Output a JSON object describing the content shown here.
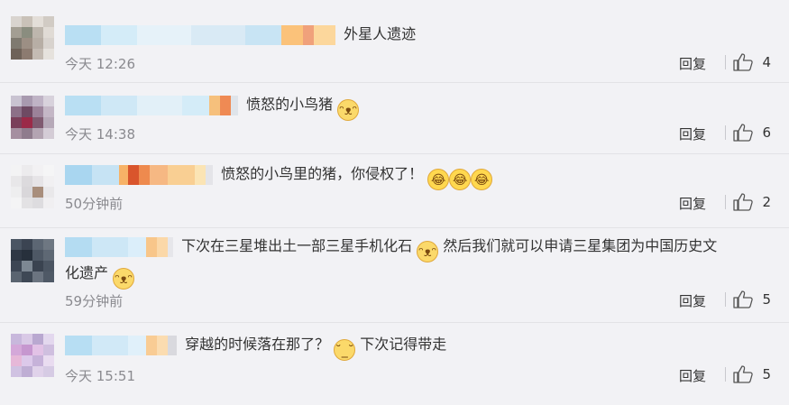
{
  "comments": [
    {
      "text": "外星人遗迹",
      "time": "今天 12:26",
      "reply": "回复",
      "likes": "4"
    },
    {
      "text": "愤怒的小鸟猪",
      "time": "今天 14:38",
      "reply": "回复",
      "likes": "6"
    },
    {
      "text": "愤怒的小鸟里的猪，你侵权了！",
      "time": "50分钟前",
      "reply": "回复",
      "likes": "2"
    },
    {
      "text": "下次在三星堆出土一部三星手机化石",
      "text_after": "然后我们就可以申请三星集团为中国历史文",
      "text_line2": "化遗产",
      "time": "59分钟前",
      "reply": "回复",
      "likes": "5"
    },
    {
      "text": "穿越的时候落在那了？",
      "text_after": "下次记得带走",
      "time": "今天 15:51",
      "reply": "回复",
      "likes": "5"
    }
  ],
  "icons": {
    "like": "thumbs-up-icon",
    "emoji_dog": "dog-face-emoji-icon",
    "emoji_laugh": "laughing-tears-emoji-icon",
    "emoji_sweat": "sweat-smile-emoji-icon"
  }
}
